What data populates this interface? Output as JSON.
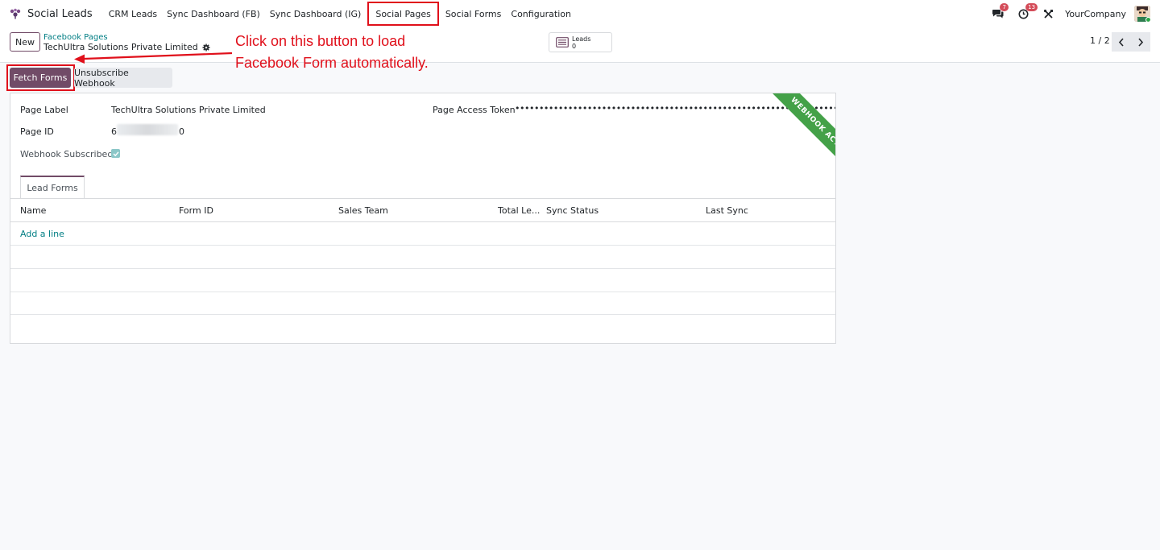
{
  "navbar": {
    "app_name": "Social Leads",
    "menu": [
      "CRM Leads",
      "Sync Dashboard (FB)",
      "Sync Dashboard (IG)",
      "Social Pages",
      "Social Forms",
      "Configuration"
    ],
    "messages_count": "7",
    "activities_count": "13",
    "company": "YourCompany"
  },
  "control": {
    "new_label": "New",
    "breadcrumb_parent": "Facebook Pages",
    "breadcrumb_current": "TechUltra Solutions Private Limited",
    "smart_button": {
      "label": "Leads",
      "value": "0"
    },
    "pager": "1 / 2"
  },
  "annotation": {
    "line1": "Click on this button to load",
    "line2": "Facebook Form automatically."
  },
  "actions": {
    "fetch_forms": "Fetch Forms",
    "unsubscribe_webhook": "Unsubscribe Webhook"
  },
  "form": {
    "page_label_label": "Page Label",
    "page_label_value": "TechUltra Solutions Private Limited",
    "page_id_label": "Page ID",
    "page_id_prefix": "6",
    "page_id_suffix": "0",
    "webhook_subscribed_label": "Webhook Subscribed",
    "webhook_subscribed": true,
    "page_access_token_label": "Page Access Token",
    "page_access_token_value": "••••••••••••••••••••••••••••••••••••••••••••••••••••••••••••••••••••••••••••••••••••••••",
    "ribbon": "WEBHOOK ACTIVE"
  },
  "tab": {
    "label": "Lead Forms"
  },
  "table": {
    "columns": [
      "Name",
      "Form ID",
      "Sales Team",
      "Total Le...",
      "Sync Status",
      "Last Sync"
    ],
    "add_line": "Add a line"
  },
  "colors": {
    "primary": "#714b67",
    "annotation_red": "#e0101b",
    "link_teal": "#017e84",
    "ribbon_green": "#44a148"
  }
}
